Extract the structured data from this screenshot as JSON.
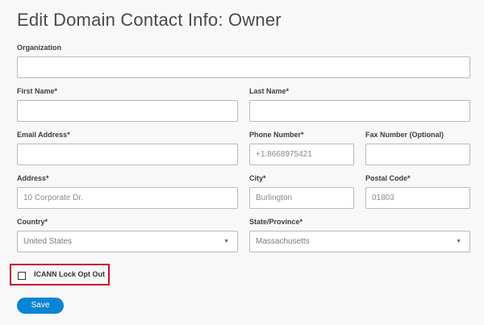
{
  "page": {
    "title": "Edit Domain Contact Info: Owner"
  },
  "form": {
    "organization": {
      "label": "Organization",
      "value": ""
    },
    "first_name": {
      "label": "First Name*",
      "value": ""
    },
    "last_name": {
      "label": "Last Name*",
      "value": ""
    },
    "email": {
      "label": "Email Address*",
      "value": ""
    },
    "phone": {
      "label": "Phone Number*",
      "value": "+1.8668975421"
    },
    "fax": {
      "label": "Fax Number (Optional)",
      "value": ""
    },
    "address": {
      "label": "Address*",
      "value": "10 Corporate Dr."
    },
    "city": {
      "label": "City*",
      "value": "Burlington"
    },
    "postal_code": {
      "label": "Postal Code*",
      "value": "01803"
    },
    "country": {
      "label": "Country*",
      "value": "United States"
    },
    "state": {
      "label": "State/Province*",
      "value": "Massachusetts"
    },
    "icann_lock": {
      "label": "ICANN Lock Opt Out",
      "checked": false
    },
    "save_label": "Save"
  },
  "icons": {
    "dropdown": "chevron-down-icon",
    "checkbox": "checkbox-icon"
  },
  "colors": {
    "accent": "#0a85d3",
    "highlight_border": "#c8102e"
  }
}
